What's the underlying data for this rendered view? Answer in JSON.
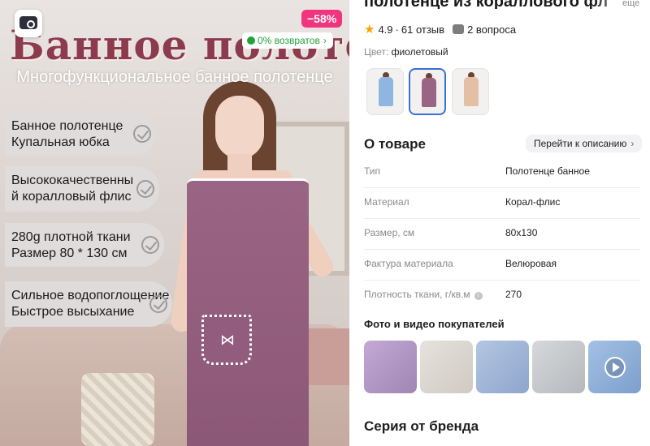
{
  "hero": {
    "headline": "Банное полотенце",
    "subheadline": "Многофункциональное банное полотенце",
    "features": [
      {
        "lines": [
          "Банное полотенце",
          "Купальная юбка"
        ]
      },
      {
        "lines": [
          "Высококачественны",
          "й коралловый флис"
        ]
      },
      {
        "lines": [
          "280g плотной ткани",
          "Размер 80 * 130 см"
        ]
      },
      {
        "lines": [
          "Сильное водопоглощение",
          "Быстрое высыхание"
        ]
      }
    ],
    "discount": "−58%",
    "returns_badge": "0% возвратов",
    "search_photo_icon": "image-search-icon"
  },
  "product": {
    "title": "полотенце из кораллового фл",
    "title_more": "еще",
    "rating": "4.9",
    "reviews": "61 отзыв",
    "questions": "2 вопроса",
    "color_label": "Цвет:",
    "color_value": "фиолетовый",
    "swatches": [
      {
        "color": "#8fb6e0",
        "selected": false
      },
      {
        "color": "#9a6585",
        "selected": true
      },
      {
        "color": "#e3bfa6",
        "selected": false
      }
    ]
  },
  "about": {
    "title": "О товаре",
    "goto_description": "Перейти к описанию",
    "specs": [
      {
        "key": "Тип",
        "value": "Полотенце банное"
      },
      {
        "key": "Материал",
        "value": "Корал-флис"
      },
      {
        "key": "Размер, см",
        "value": "80х130"
      },
      {
        "key": "Фактура материала",
        "value": "Велюровая"
      },
      {
        "key": "Плотность ткани, г/кв.м",
        "value": "270"
      }
    ]
  },
  "photos": {
    "title": "Фото и видео покупателей",
    "thumbs": [
      {
        "color": "#b59ac6"
      },
      {
        "color": "#dcd9d3"
      },
      {
        "color": "#9eb4d6"
      },
      {
        "color": "#c7c9cc"
      },
      {
        "color": "#8fb0d8",
        "video": true
      }
    ]
  },
  "series": {
    "title": "Серия от бренда"
  },
  "colors": {
    "accent_blue": "#3b6fd8",
    "discount_pink": "#f0357d",
    "returns_green": "#22a33a",
    "star": "#ff9f00"
  }
}
